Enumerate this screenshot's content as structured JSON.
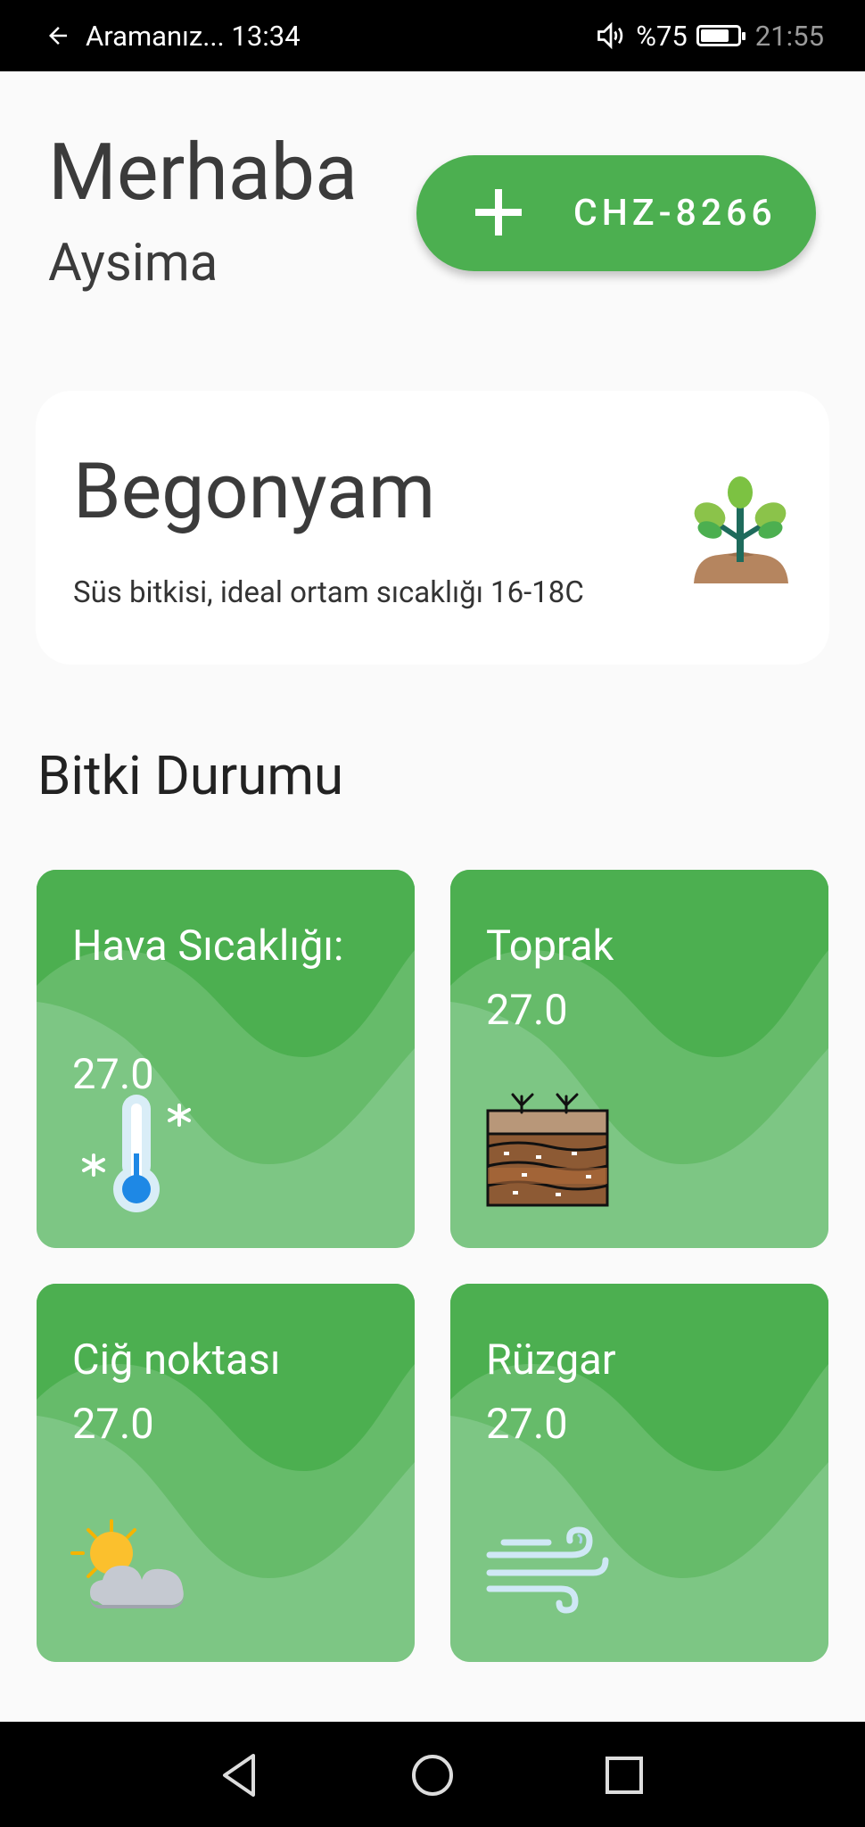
{
  "status_bar": {
    "back_label": "Aramanız... 13:34",
    "battery_text": "%75",
    "time": "21:55"
  },
  "greeting": {
    "hello": "Merhaba",
    "name": "Aysima"
  },
  "add_device": {
    "code": "CHZ-8266"
  },
  "plant": {
    "name": "Begonyam",
    "description": "Süs bitkisi, ideal ortam sıcaklığı 16-18C"
  },
  "section": {
    "title": "Bitki Durumu"
  },
  "tiles": [
    {
      "label": "Hava Sıcaklığı:",
      "value": "27.0",
      "icon": "thermometer-icon"
    },
    {
      "label": "Toprak",
      "value": "27.0",
      "icon": "soil-icon"
    },
    {
      "label": "Ciğ noktası",
      "value": "27.0",
      "icon": "partly-cloudy-icon"
    },
    {
      "label": "Rüzgar",
      "value": "27.0",
      "icon": "wind-icon"
    }
  ],
  "colors": {
    "accent": "#4caf50",
    "tile_light": "#7dc684",
    "tile_mid": "#66bb6a",
    "tile_dark": "#4caf50"
  }
}
